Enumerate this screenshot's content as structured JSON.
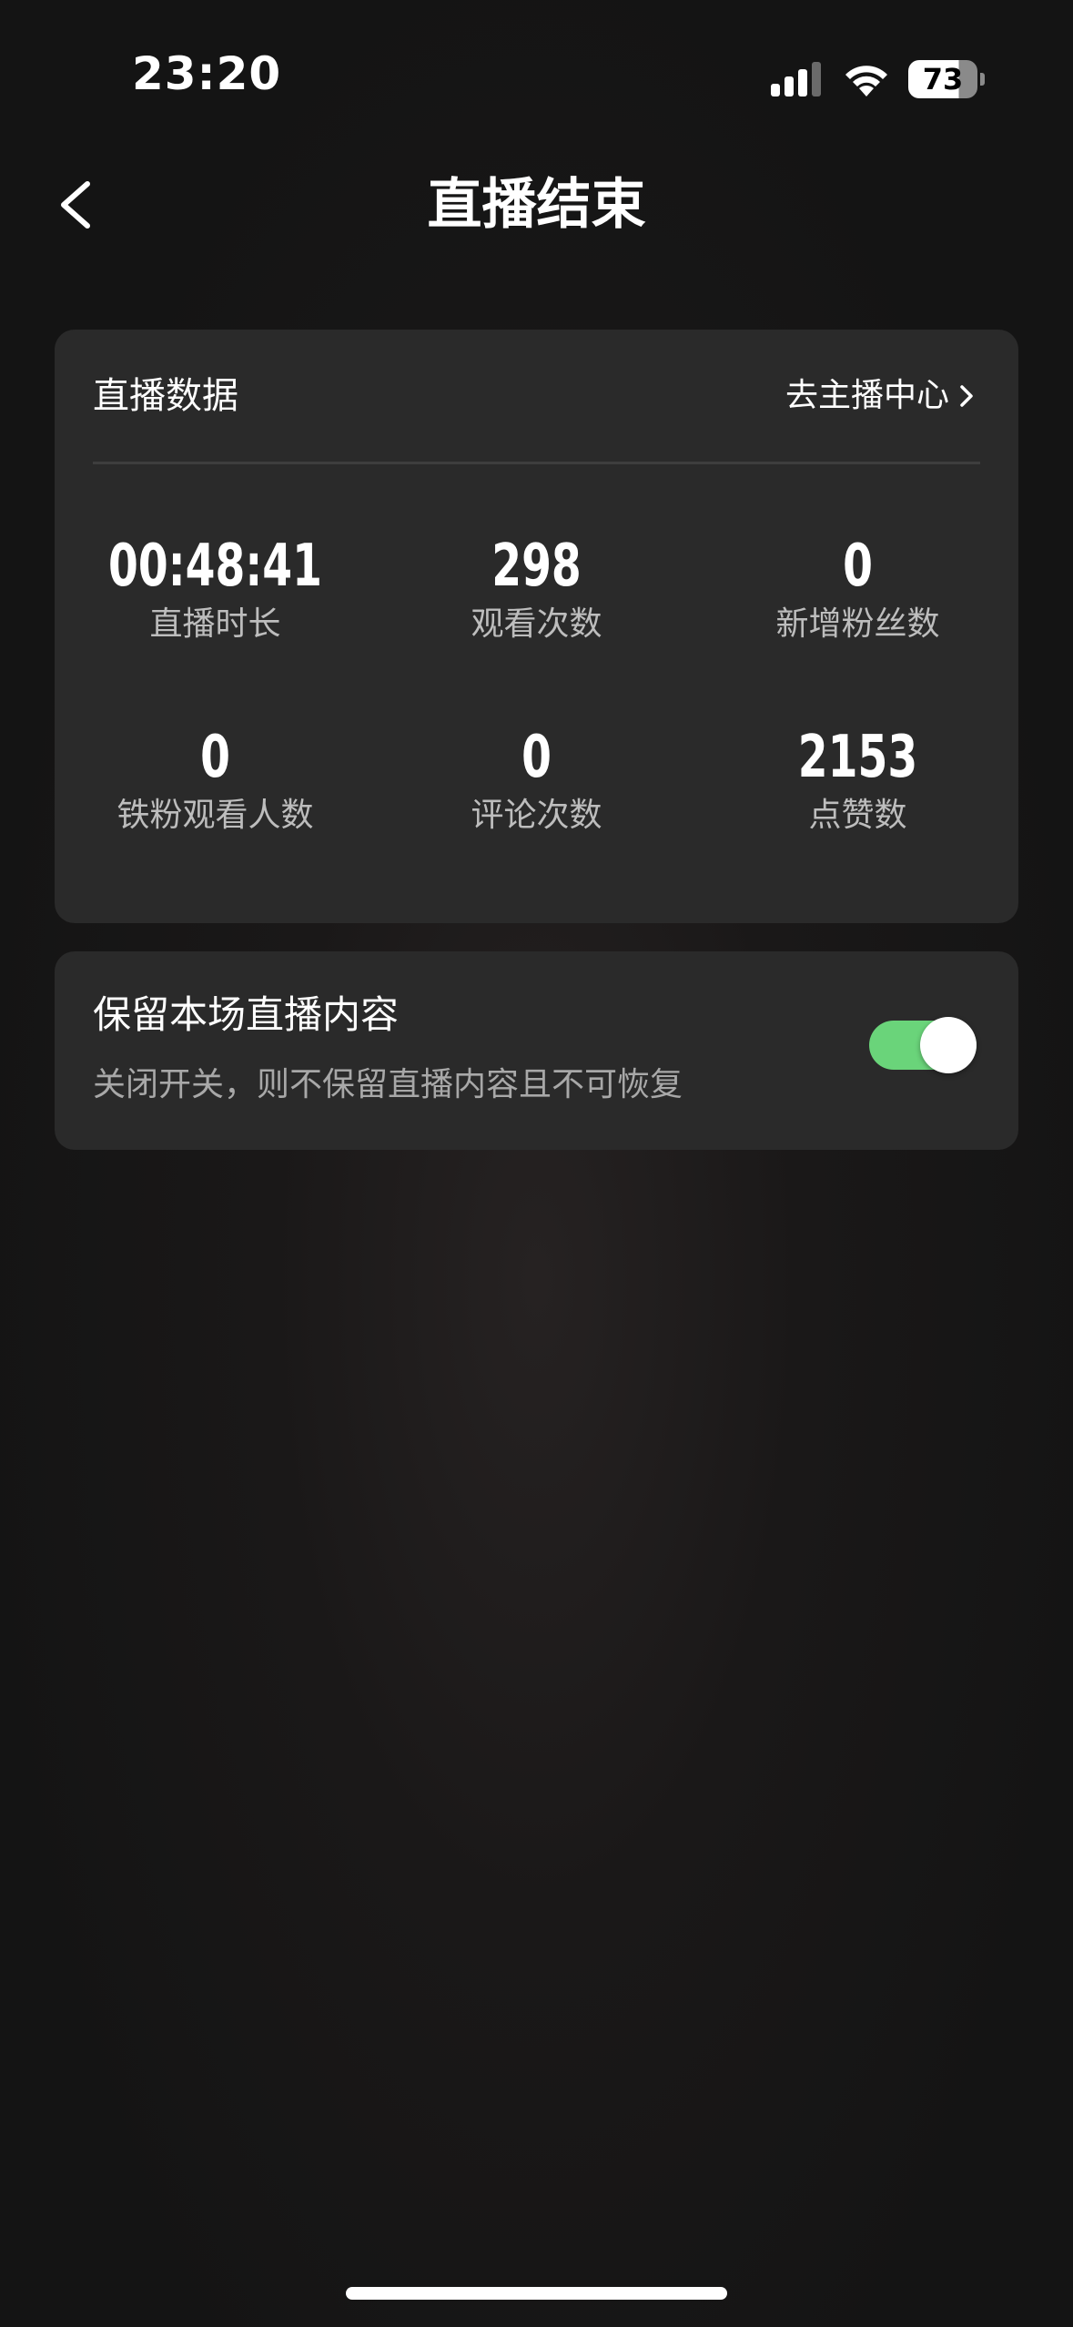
{
  "status_bar": {
    "time": "23:20",
    "battery_level": "73",
    "battery_percent": 73,
    "signal_icon": "cellular-signal-icon",
    "wifi_icon": "wifi-icon"
  },
  "nav": {
    "back_icon": "chevron-left-icon",
    "title": "直播结束"
  },
  "stats_card": {
    "header": "直播数据",
    "link_label": "去主播中心",
    "link_icon": "chevron-right-icon",
    "stats": [
      {
        "value": "00:48:41",
        "label": "直播时长"
      },
      {
        "value": "298",
        "label": "观看次数"
      },
      {
        "value": "0",
        "label": "新增粉丝数"
      },
      {
        "value": "0",
        "label": "铁粉观看人数"
      },
      {
        "value": "0",
        "label": "评论次数"
      },
      {
        "value": "2153",
        "label": "点赞数"
      }
    ]
  },
  "retain_card": {
    "title": "保留本场直播内容",
    "description": "关闭开关，则不保留直播内容且不可恢复",
    "toggle_on": true
  },
  "colors": {
    "background": "#151515",
    "card": "#2a2a2a",
    "toggle_on": "#6ad47a",
    "secondary_text": "#bdbdbd"
  }
}
